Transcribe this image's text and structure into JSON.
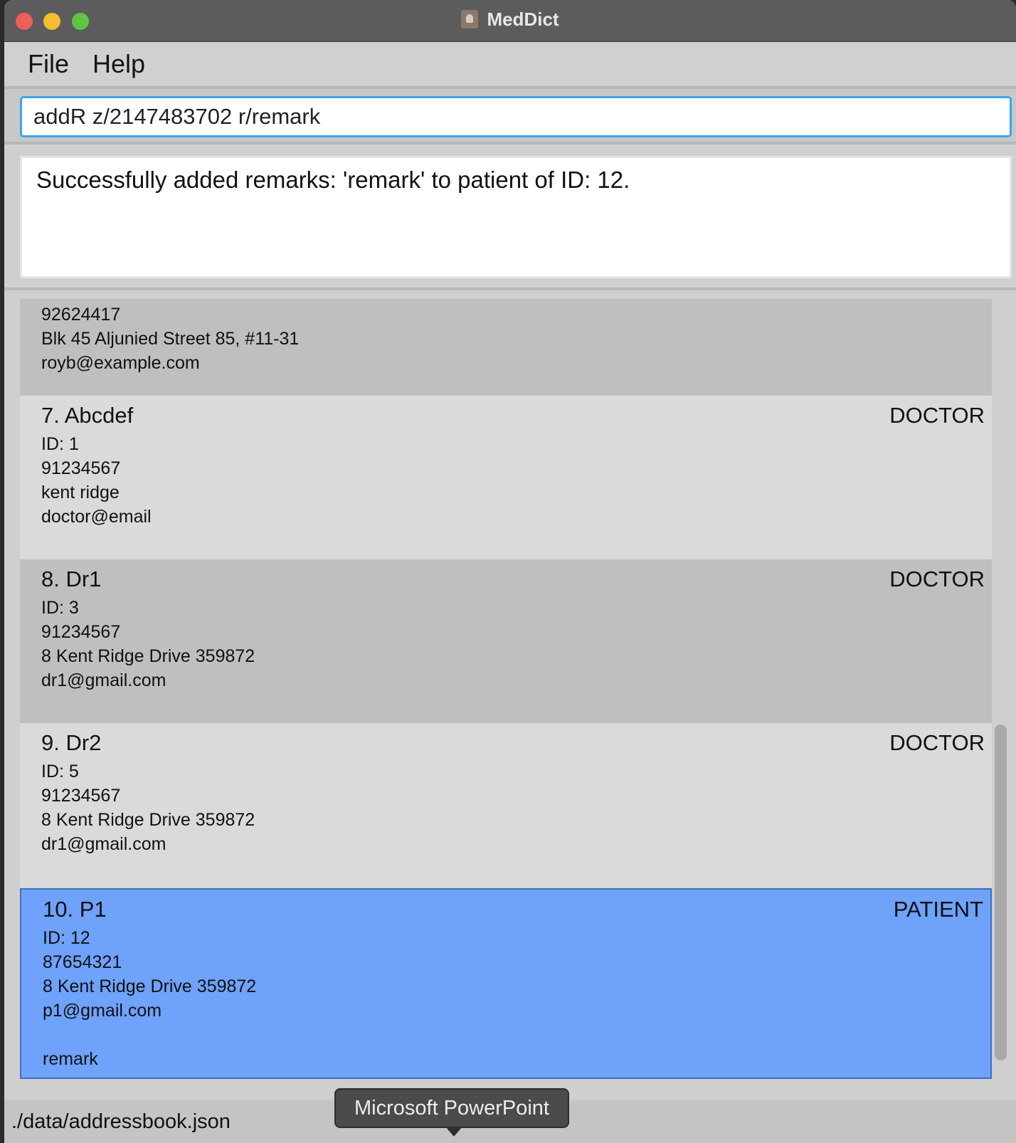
{
  "window": {
    "title": "MedDict"
  },
  "menu": {
    "file": "File",
    "help": "Help"
  },
  "command": {
    "value": "addR z/2147483702 r/remark"
  },
  "result": {
    "message": "Successfully added remarks: 'remark' to patient of ID: 12."
  },
  "cards": {
    "c6": {
      "phone": "92624417",
      "address": "Blk 45 Aljunied Street 85, #11-31",
      "email": "royb@example.com"
    },
    "c7": {
      "name": "7. Abcdef",
      "role": "DOCTOR",
      "id": "ID: 1",
      "phone": "91234567",
      "address": "kent ridge",
      "email": "doctor@email"
    },
    "c8": {
      "name": "8. Dr1",
      "role": "DOCTOR",
      "id": "ID: 3",
      "phone": "91234567",
      "address": "8 Kent Ridge Drive 359872",
      "email": "dr1@gmail.com"
    },
    "c9": {
      "name": "9. Dr2",
      "role": "DOCTOR",
      "id": "ID: 5",
      "phone": "91234567",
      "address": "8 Kent Ridge Drive 359872",
      "email": "dr1@gmail.com"
    },
    "c10": {
      "name": "10. P1",
      "role": "PATIENT",
      "id": "ID: 12",
      "phone": "87654321",
      "address": "8 Kent Ridge Drive 359872",
      "email": "p1@gmail.com",
      "remark": "remark"
    }
  },
  "status": {
    "path": "./data/addressbook.json"
  },
  "tooltip": {
    "text": "Microsoft PowerPoint"
  },
  "colors": {
    "selected": "#6ea2fb",
    "accent": "#3aa6e8"
  }
}
